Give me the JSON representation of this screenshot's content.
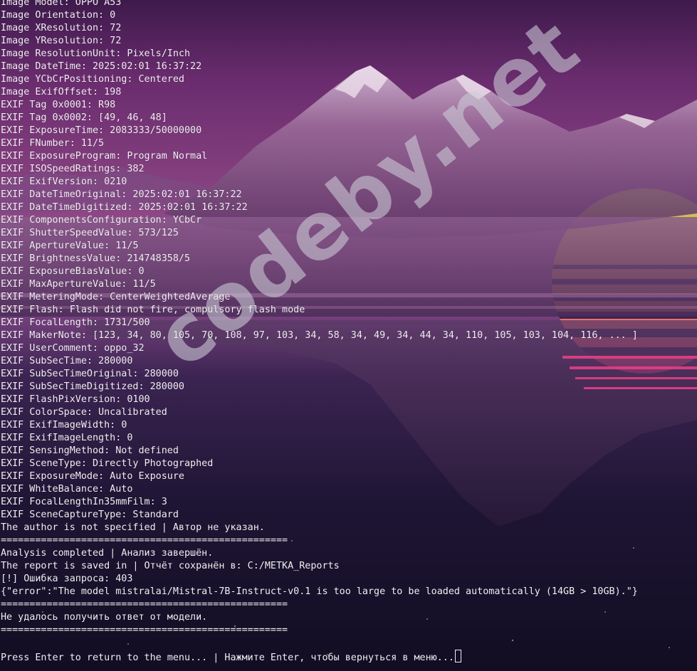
{
  "terminal": {
    "lines": [
      "Image Model: OPPO A53",
      "Image Orientation: 0",
      "Image XResolution: 72",
      "Image YResolution: 72",
      "Image ResolutionUnit: Pixels/Inch",
      "Image DateTime: 2025:02:01 16:37:22",
      "Image YCbCrPositioning: Centered",
      "Image ExifOffset: 198",
      "EXIF Tag 0x0001: R98",
      "EXIF Tag 0x0002: [49, 46, 48]",
      "EXIF ExposureTime: 2083333/50000000",
      "EXIF FNumber: 11/5",
      "EXIF ExposureProgram: Program Normal",
      "EXIF ISOSpeedRatings: 382",
      "EXIF ExifVersion: 0210",
      "EXIF DateTimeOriginal: 2025:02:01 16:37:22",
      "EXIF DateTimeDigitized: 2025:02:01 16:37:22",
      "EXIF ComponentsConfiguration: YCbCr",
      "EXIF ShutterSpeedValue: 573/125",
      "EXIF ApertureValue: 11/5",
      "EXIF BrightnessValue: 214748358/5",
      "EXIF ExposureBiasValue: 0",
      "EXIF MaxApertureValue: 11/5",
      "EXIF MeteringMode: CenterWeightedAverage",
      "EXIF Flash: Flash did not fire, compulsory flash mode",
      "EXIF FocalLength: 1731/500",
      "EXIF MakerNote: [123, 34, 80, 105, 70, 108, 97, 103, 34, 58, 34, 49, 34, 44, 34, 110, 105, 103, 104, 116, ... ]",
      "EXIF UserComment: oppo_32",
      "EXIF SubSecTime: 280000",
      "EXIF SubSecTimeOriginal: 280000",
      "EXIF SubSecTimeDigitized: 280000",
      "EXIF FlashPixVersion: 0100",
      "EXIF ColorSpace: Uncalibrated",
      "EXIF ExifImageWidth: 0",
      "EXIF ExifImageLength: 0",
      "EXIF SensingMethod: Not defined",
      "EXIF SceneType: Directly Photographed",
      "EXIF ExposureMode: Auto Exposure",
      "EXIF WhiteBalance: Auto",
      "EXIF FocalLengthIn35mmFilm: 3",
      "EXIF SceneCaptureType: Standard",
      "The author is not specified | Автор не указан.",
      "==================================================",
      "Analysis completed | Анализ завершён.",
      "The report is saved in | Отчёт сохранён в: C:/METKA_Reports",
      "[!] Ошибка запроса: 403",
      "{\"error\":\"The model mistralai/Mistral-7B-Instruct-v0.1 is too large to be loaded automatically (14GB > 10GB).\"}",
      "==================================================",
      "Не удалось получить ответ от модели.",
      "==================================================",
      ""
    ],
    "prompt": "Press Enter to return to the menu... | Нажмите Enter, чтобы вернуться в меню..."
  },
  "watermark": {
    "text": "codeby.net"
  },
  "colors": {
    "text": "#f2eef4",
    "sky_top": "#4a1f55",
    "sky_mid": "#7a3a78",
    "sun_top": "#c8d84a",
    "sun_bottom": "#e8458a"
  }
}
